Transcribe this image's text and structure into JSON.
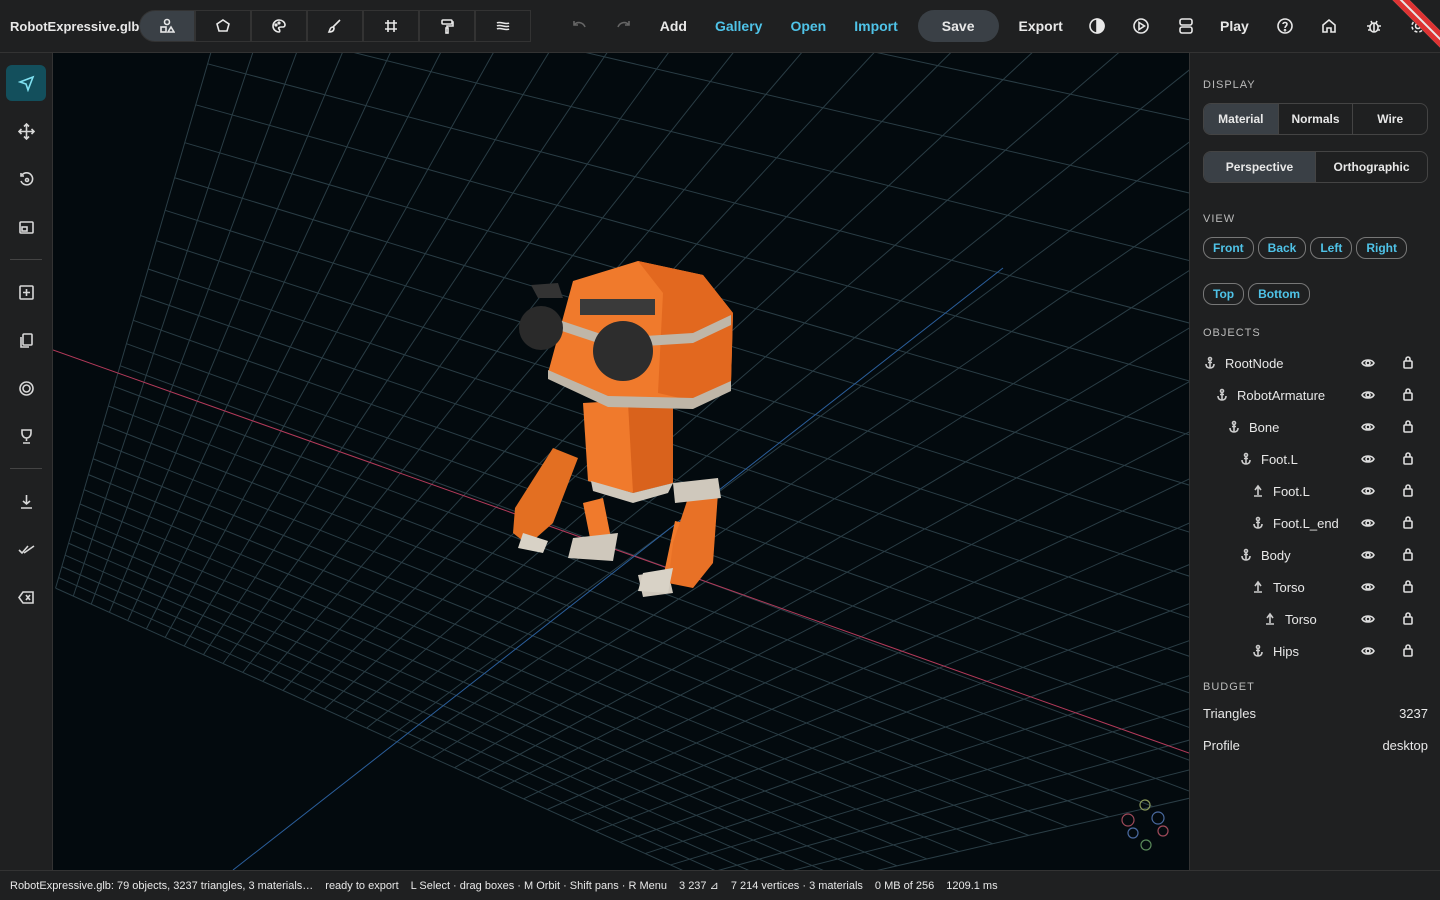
{
  "app": {
    "title": "RobotExpressive.glb"
  },
  "modes": [
    {
      "icon": "shapes-icon",
      "active": true
    },
    {
      "icon": "polygon-icon"
    },
    {
      "icon": "palette-icon"
    },
    {
      "icon": "brush-icon"
    },
    {
      "icon": "grid-icon"
    },
    {
      "icon": "paint-roller-icon"
    },
    {
      "icon": "layers-icon"
    }
  ],
  "toolbar": {
    "add": "Add",
    "gallery": "Gallery",
    "open": "Open",
    "import": "Import",
    "save": "Save",
    "export": "Export",
    "play": "Play"
  },
  "left_tools": [
    "select-tool-icon",
    "move-tool-icon",
    "rotate-tool-icon",
    "scale-tool-icon",
    "add-object-icon",
    "duplicate-icon",
    "target-icon",
    "trophy-icon",
    "download-icon",
    "check-all-icon",
    "delete-icon"
  ],
  "panel": {
    "display_title": "DISPLAY",
    "display_modes": [
      "Material",
      "Normals",
      "Wire"
    ],
    "projection_modes": [
      "Perspective",
      "Orthographic"
    ],
    "view_title": "VIEW",
    "views_row1": [
      "Front",
      "Back",
      "Left",
      "Right"
    ],
    "views_row2": [
      "Top",
      "Bottom"
    ],
    "objects_title": "OBJECTS",
    "objects": [
      {
        "name": "RootNode",
        "depth": 0,
        "icon": "anchor-icon"
      },
      {
        "name": "RobotArmature",
        "depth": 1,
        "icon": "anchor-icon"
      },
      {
        "name": "Bone",
        "depth": 2,
        "icon": "anchor-icon"
      },
      {
        "name": "Foot.L",
        "depth": 3,
        "icon": "anchor-icon"
      },
      {
        "name": "Foot.L",
        "depth": 4,
        "icon": "bone-icon"
      },
      {
        "name": "Foot.L_end",
        "depth": 4,
        "icon": "anchor-icon"
      },
      {
        "name": "Body",
        "depth": 3,
        "icon": "anchor-icon"
      },
      {
        "name": "Torso",
        "depth": 4,
        "icon": "bone-icon"
      },
      {
        "name": "Torso",
        "depth": 5,
        "icon": "bone-icon"
      },
      {
        "name": "Hips",
        "depth": 4,
        "icon": "anchor-icon"
      }
    ],
    "budget_title": "BUDGET",
    "triangles_label": "Triangles",
    "triangles_value": "3237",
    "profile_label": "Profile",
    "profile_value": "desktop"
  },
  "status": {
    "summary": "RobotExpressive.glb: 79 objects, 3237 triangles, 3 materials…",
    "state": "ready to export",
    "hints": "L Select · drag boxes · M Orbit · Shift pans · R Menu",
    "tri_count": "3 237 ⊿",
    "mesh_info": "7 214 vertices · 3 materials",
    "memory": "0 MB of 256",
    "frame_time": "1209.1 ms"
  },
  "colors": {
    "accent": "#4fc3e8",
    "robot_orange": "#f07a2c",
    "active_tool": "#134f5c"
  }
}
